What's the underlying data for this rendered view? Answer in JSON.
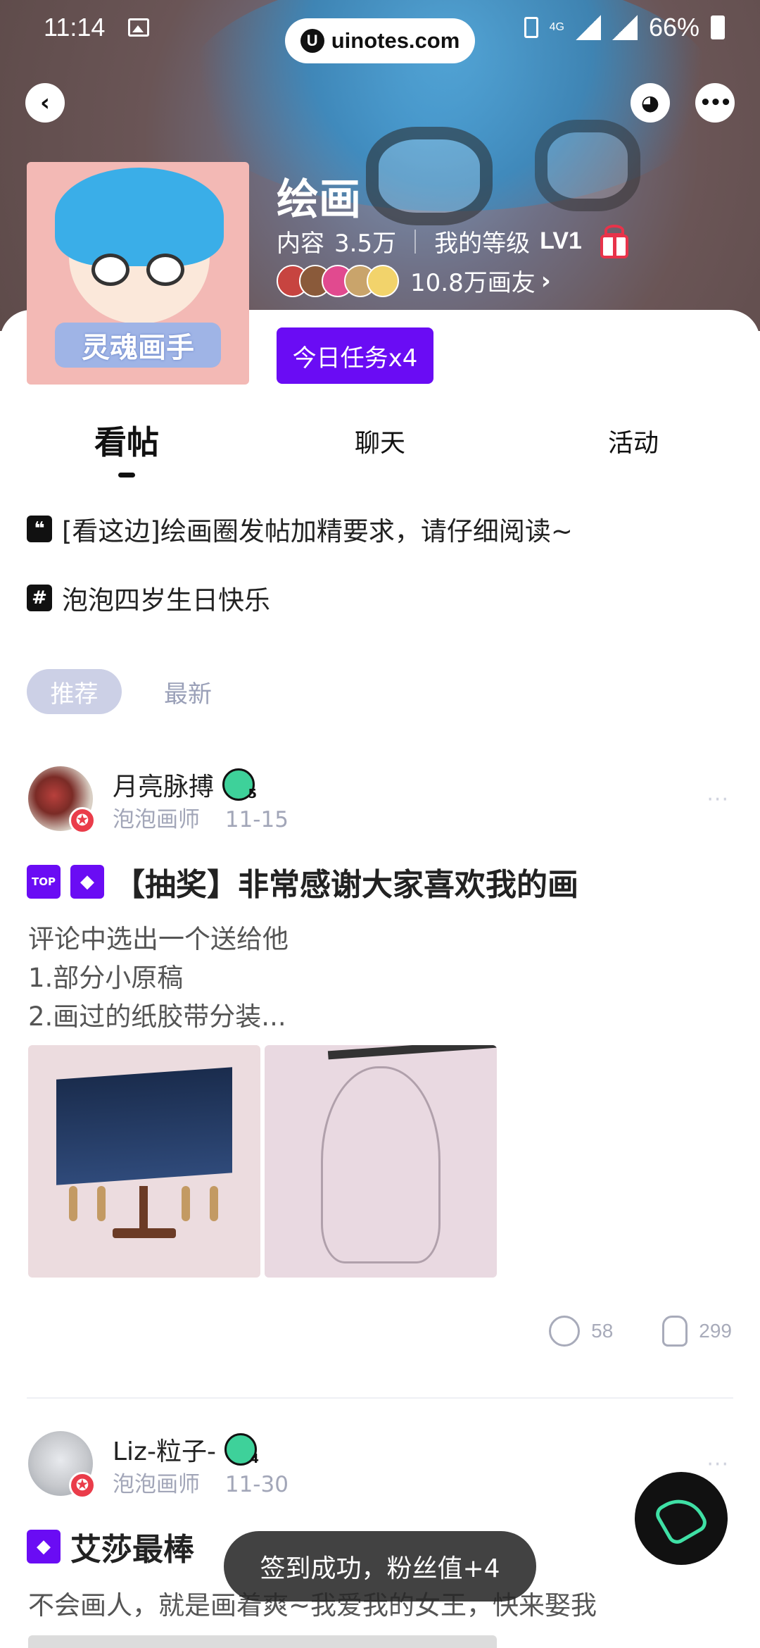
{
  "status_bar": {
    "time": "11:14",
    "url_pill": "uinotes.com",
    "network": "4G",
    "battery": "66%"
  },
  "header": {
    "back_icon": "chevron-left-icon",
    "explore_icon": "planet-icon",
    "more_icon": "more-dots-icon"
  },
  "group": {
    "avatar_badge": "灵魂画手",
    "title": "绘画",
    "content_label": "内容",
    "content_count": "3.5万",
    "level_label": "我的等级",
    "level_value": "LV1",
    "members_text": "10.8万画友",
    "members_chevron": "›",
    "task_button": "今日任务x4"
  },
  "tabs": [
    {
      "label": "看帖",
      "active": true
    },
    {
      "label": "聊天",
      "active": false
    },
    {
      "label": "活动",
      "active": false
    }
  ],
  "notices": [
    {
      "icon": "quote-icon",
      "glyph": "❝",
      "text": "[看这边]绘画圈发帖加精要求，请仔细阅读~"
    },
    {
      "icon": "hashtag-icon",
      "glyph": "#",
      "text": "泡泡四岁生日快乐"
    }
  ],
  "filters": {
    "recommended": "推荐",
    "latest": "最新"
  },
  "posts": [
    {
      "author": "月亮脉搏",
      "level": "5",
      "role": "泡泡画师",
      "date": "11-15",
      "more": "···",
      "top_tag": "TOP",
      "title": "【抽奖】非常感谢大家喜欢我的画",
      "body_lines": [
        "评论中选出一个送给他",
        "1.部分小原稿",
        "2.画过的纸胶带分装..."
      ],
      "comments": "58",
      "likes": "299"
    },
    {
      "author": "Liz-粒子-",
      "level": "4",
      "role": "泡泡画师",
      "date": "11-30",
      "more": "···",
      "title": "艾莎最棒",
      "body": "不会画人，就是画着爽~我爱我的女王，快来娶我"
    }
  ],
  "toast": "签到成功，粉丝值+4",
  "colors": {
    "accent": "#6a0cf4",
    "fab_bg": "#111111",
    "fab_icon": "#3fe0a5",
    "chip_bg": "#ccd0e6"
  }
}
